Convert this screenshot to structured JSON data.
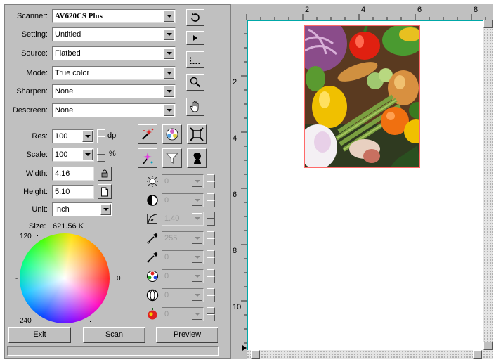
{
  "scanner_panel": {
    "scanner": {
      "label": "Scanner:",
      "value": "AV620CS Plus"
    },
    "setting": {
      "label": "Setting:",
      "value": "Untitled"
    },
    "source": {
      "label": "Source:",
      "value": "Flatbed"
    },
    "mode": {
      "label": "Mode:",
      "value": "True color"
    },
    "sharpen": {
      "label": "Sharpen:",
      "value": "None"
    },
    "descreen": {
      "label": "Descreen:",
      "value": "None"
    },
    "res": {
      "label": "Res:",
      "value": "100",
      "unit": "dpi"
    },
    "scale": {
      "label": "Scale:",
      "value": "100",
      "unit": "%"
    },
    "width": {
      "label": "Width:",
      "value": "4.16"
    },
    "height": {
      "label": "Height:",
      "value": "5.10"
    },
    "unit": {
      "label": "Unit:",
      "value": "Inch"
    },
    "size": {
      "label": "Size:",
      "value": "621.56 K"
    }
  },
  "color_wheel": {
    "label_top": "120",
    "label_bottom": "240",
    "label_right": "0"
  },
  "adjustments": [
    {
      "icon": "brightness-icon",
      "value": "0"
    },
    {
      "icon": "contrast-icon",
      "value": "0"
    },
    {
      "icon": "gamma-icon",
      "value": "1.40"
    },
    {
      "icon": "highlight-eyedropper-icon",
      "value": "255"
    },
    {
      "icon": "shadow-eyedropper-icon",
      "value": "0"
    },
    {
      "icon": "color-balance-icon",
      "value": "0"
    },
    {
      "icon": "saturation-icon",
      "value": "0"
    },
    {
      "icon": "hue-icon",
      "value": "0"
    }
  ],
  "buttons": {
    "exit": "Exit",
    "scan": "Scan",
    "preview": "Preview"
  },
  "ruler_top": [
    "2",
    "4",
    "6",
    "8"
  ],
  "ruler_left": [
    "2",
    "4",
    "6",
    "8",
    "10"
  ],
  "colors": {
    "window": "#c0c0c0",
    "ruler_line": "#00a8a8",
    "selection": "#ff6a6a"
  }
}
